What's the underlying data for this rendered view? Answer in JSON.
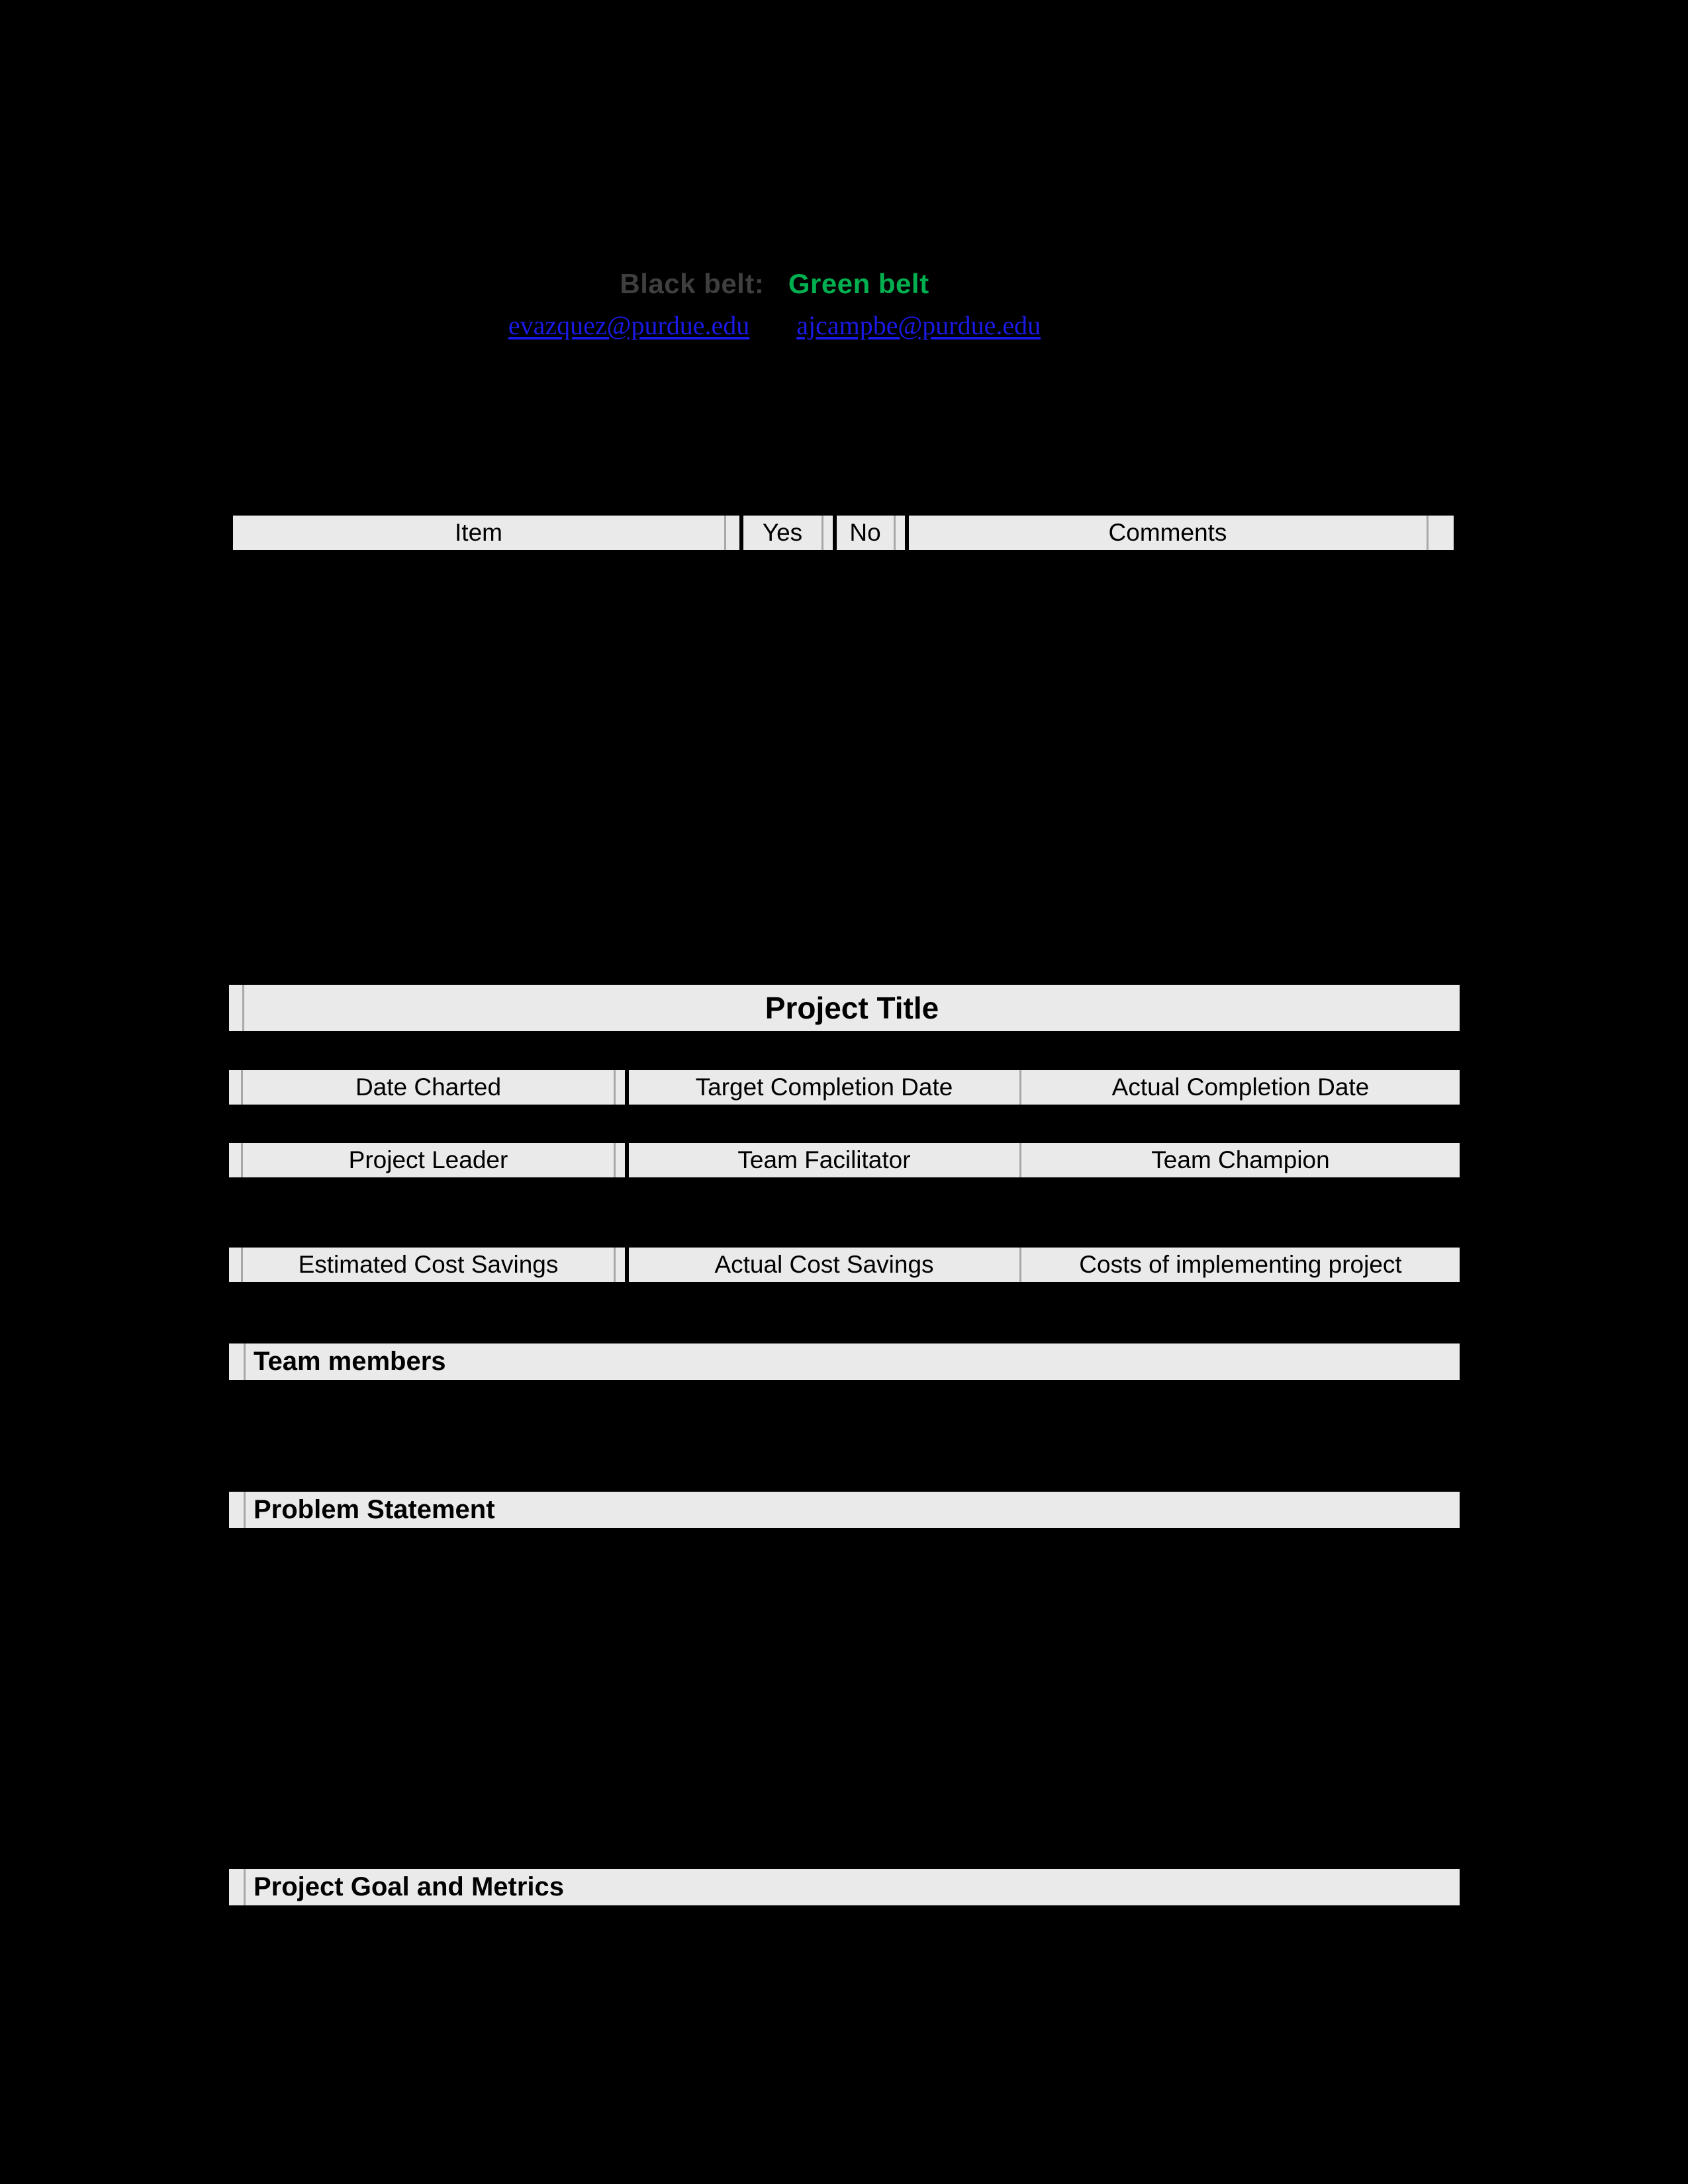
{
  "header": {
    "black_belt_label": "Black belt:",
    "green_belt_label": "Green belt",
    "black_belt_email": "evazquez@purdue.edu",
    "green_belt_email": "ajcampbe@purdue.edu",
    "black_belt_color": "#3f3f3f",
    "green_belt_color": "#00b050",
    "link_color": "#1a1ae6"
  },
  "checklist_table": {
    "columns": [
      "Item",
      "Yes",
      "No",
      "Comments"
    ]
  },
  "project_title": {
    "label": "Project Title"
  },
  "dates_row": {
    "cells": [
      "Date Charted",
      "Target Completion Date",
      "Actual Completion Date"
    ]
  },
  "people_row": {
    "cells": [
      "Project Leader",
      "Team Facilitator",
      "Team Champion"
    ]
  },
  "costs_row": {
    "cells": [
      "Estimated Cost Savings",
      "Actual Cost Savings",
      "Costs of implementing project"
    ]
  },
  "sections": {
    "team_members": "Team members",
    "problem_statement": "Problem Statement",
    "project_goal": "Project Goal and Metrics"
  },
  "theme": {
    "page_background": "#000000",
    "bar_fill": "#eaeaea",
    "rule_gray": "#a8a8a8"
  }
}
